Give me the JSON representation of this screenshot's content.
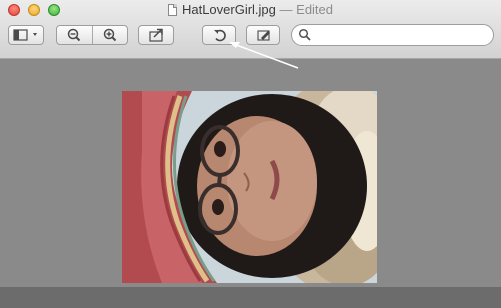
{
  "window": {
    "filename": "HatLoverGirl.jpg",
    "status": "— Edited"
  },
  "toolbar": {
    "buttons": [
      {
        "id": "sidebar",
        "icon": "sidebar-icon"
      },
      {
        "id": "zoom-out",
        "icon": "zoom-out-icon"
      },
      {
        "id": "zoom-in",
        "icon": "zoom-in-icon"
      },
      {
        "id": "share",
        "icon": "share-icon"
      },
      {
        "id": "rotate",
        "icon": "rotate-left-icon"
      },
      {
        "id": "markup",
        "icon": "markup-pen-icon"
      }
    ],
    "search": {
      "placeholder": "",
      "value": "",
      "icon": "search-icon"
    }
  },
  "colors": {
    "canvas": "#8a8a8a",
    "titlebar_top": "#ececec",
    "titlebar_bottom": "#d2d2d2",
    "annotation_arrow": "#ffffff"
  }
}
